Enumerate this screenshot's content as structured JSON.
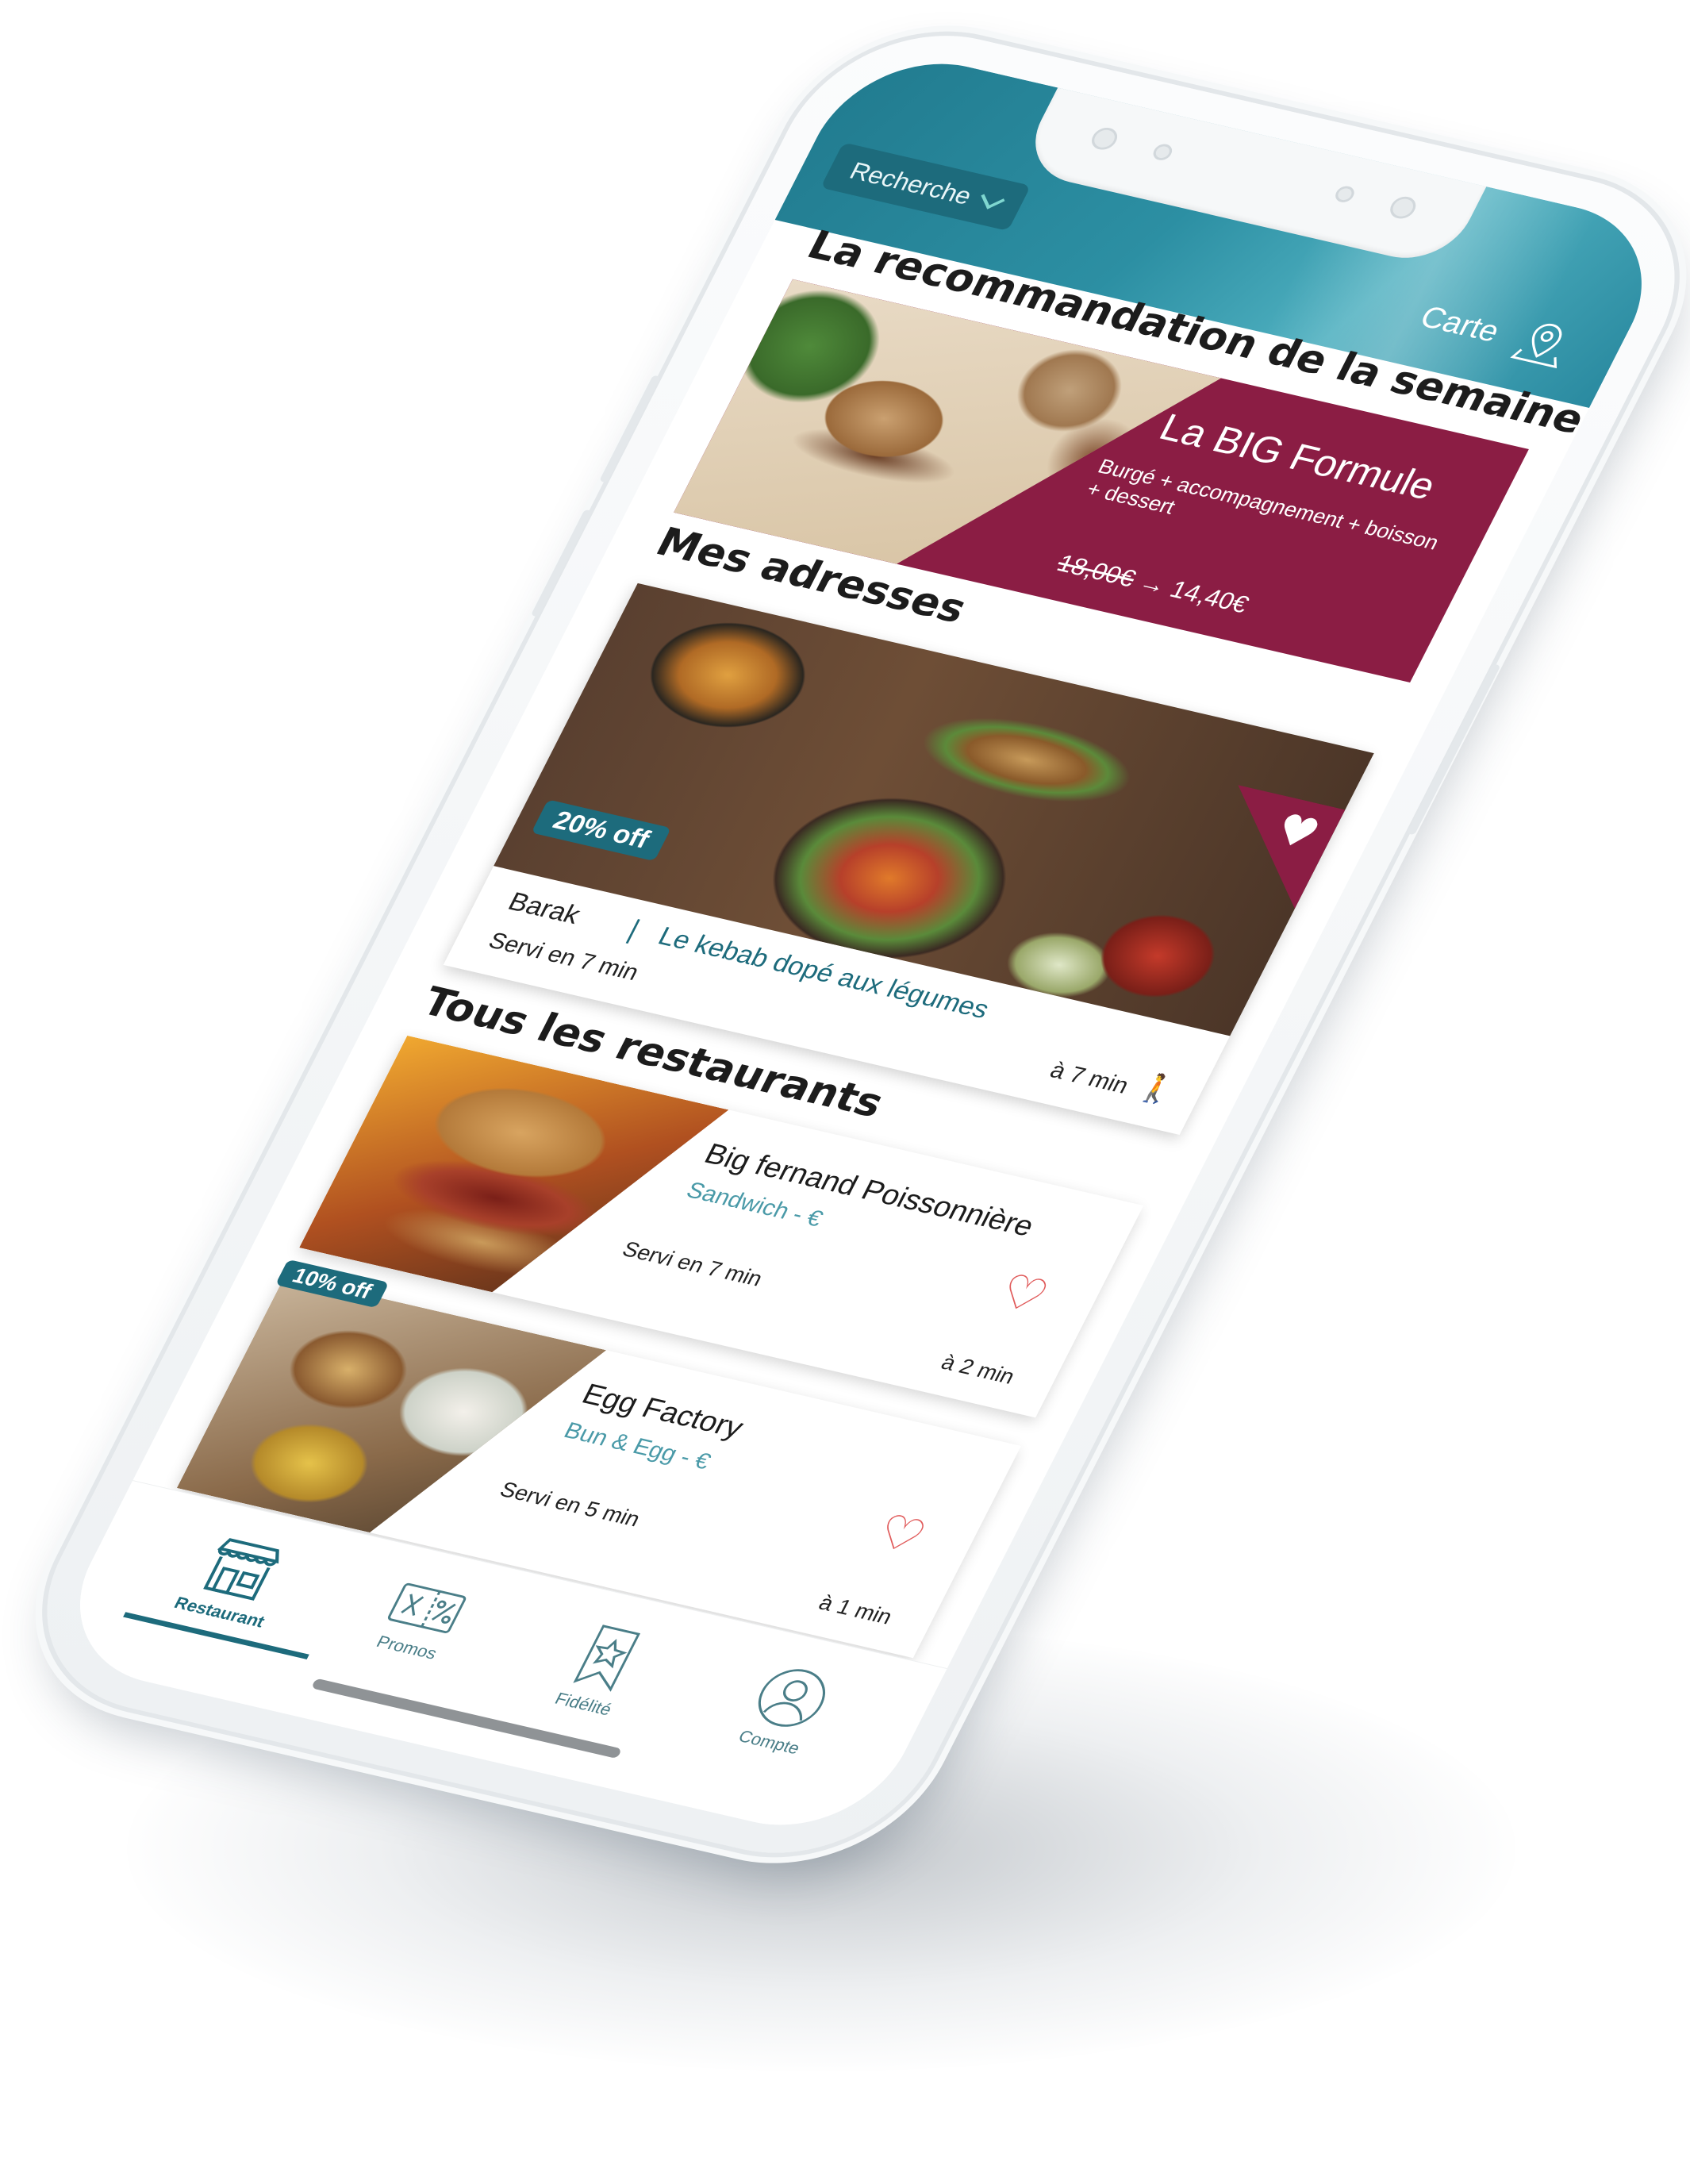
{
  "header": {
    "search_label": "Recherche",
    "map_label": "Carte"
  },
  "sections": {
    "recommendation_title": "La recommandation de la semaine",
    "addresses_title": "Mes adresses",
    "all_title": "Tous les restaurants"
  },
  "promo": {
    "title": "La BIG Formule",
    "subtitle": "Burgé + accompagnement + boisson + dessert",
    "old_price": "18,00€",
    "arrow": "→",
    "new_price": "14,40€"
  },
  "favorite": {
    "badge": "20% off",
    "name": "Barak",
    "separator": "|",
    "tagline": "Le kebab dopé aux légumes",
    "served": "Servi en 7 min",
    "distance": "à 7 min"
  },
  "restaurants": [
    {
      "name": "Big fernand Poissonnière",
      "category": "Sandwich - €",
      "served": "Servi en 7 min",
      "distance": "à 2 min"
    },
    {
      "badge": "10% off",
      "name": "Egg Factory",
      "category": "Bun & Egg - €",
      "served": "Servi en 5 min",
      "distance": "à 1 min"
    }
  ],
  "tabs": [
    {
      "label": "Restaurant",
      "icon": "store-icon",
      "active": true
    },
    {
      "label": "Promos",
      "icon": "coupon-icon",
      "active": false
    },
    {
      "label": "Fidélité",
      "icon": "star-bookmark-icon",
      "active": false
    },
    {
      "label": "Compte",
      "icon": "user-icon",
      "active": false
    }
  ],
  "colors": {
    "teal": "#1d6b7c",
    "header": "#2c8fa3",
    "promo_bg": "#8b1d44",
    "heart": "#e05a5a"
  }
}
